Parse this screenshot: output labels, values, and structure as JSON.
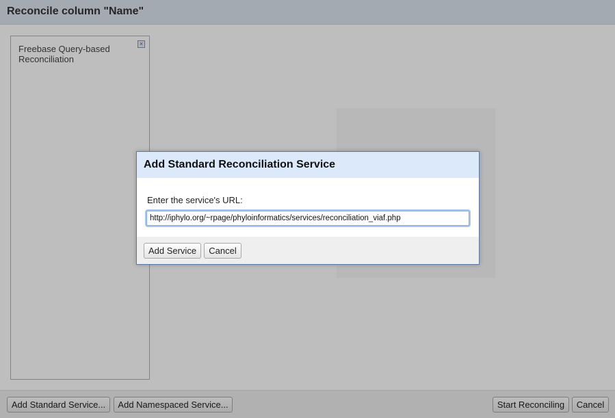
{
  "window": {
    "title": "Reconcile column \"Name\""
  },
  "services": [
    {
      "label": "Freebase Query-based Reconciliation",
      "remove_icon": "close-x-icon"
    }
  ],
  "footer": {
    "add_standard_label": "Add Standard Service...",
    "add_namespaced_label": "Add Namespaced Service...",
    "start_label": "Start Reconciling",
    "cancel_label": "Cancel"
  },
  "modal": {
    "title": "Add Standard Reconciliation Service",
    "url_label": "Enter the service's URL:",
    "url_value": "http://iphylo.org/~rpage/phyloinformatics/services/reconciliation_viaf.php",
    "add_service_label": "Add Service",
    "cancel_label": "Cancel"
  },
  "colors": {
    "header_bg": "#dbe4ef",
    "modal_header_bg": "#dce9fb",
    "modal_border": "#5b7aa5",
    "input_focus": "#a9c7ef"
  }
}
